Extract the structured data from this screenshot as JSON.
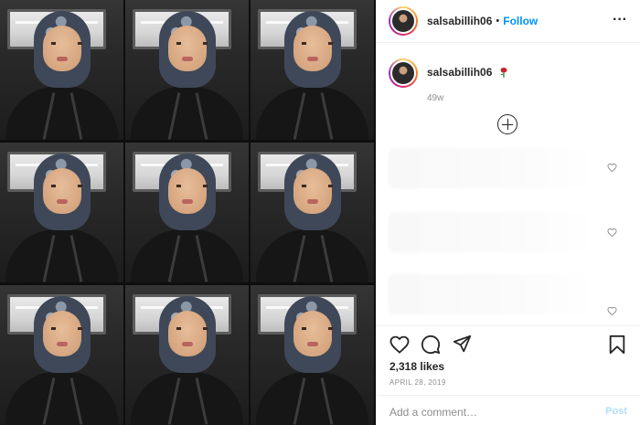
{
  "post": {
    "username": "salsabillih06",
    "separator": "•",
    "follow_label": "Follow",
    "more_label": "···",
    "caption": {
      "username": "salsabillih06",
      "emoji_icon": "rose-icon",
      "time_ago": "49w"
    },
    "load_more_icon": "plus-circle-icon",
    "likes": "2,318 likes",
    "date": "APRIL 28, 2019",
    "comment_placeholder": "Add a comment…",
    "post_label": "Post"
  },
  "photo": {
    "grid": "3x3 selfie collage",
    "tiles": 9
  },
  "colors": {
    "accent": "#0095f6",
    "post_disabled": "#b2dffc",
    "muted": "#8e8e8e",
    "text": "#262626"
  }
}
